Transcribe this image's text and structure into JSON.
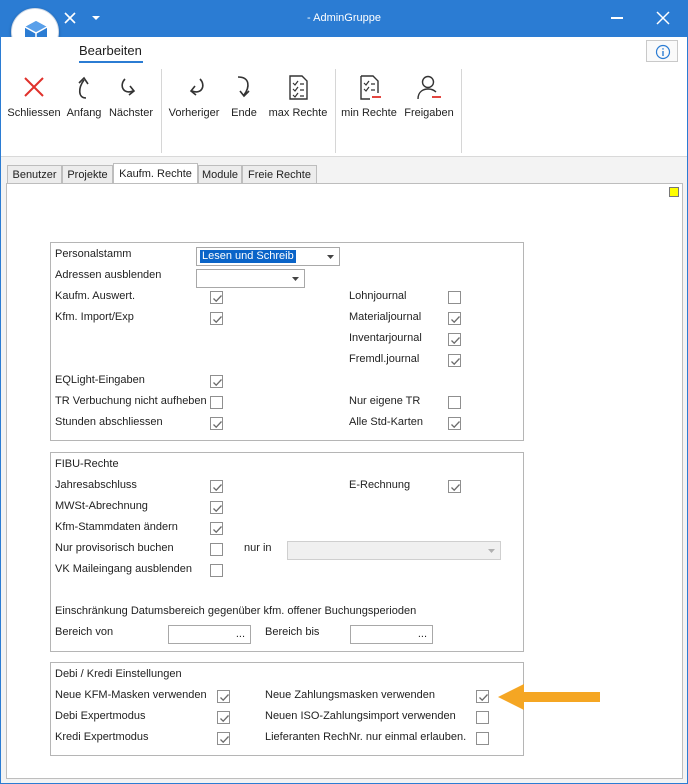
{
  "window": {
    "title": "- AdminGruppe",
    "accent": "#2b7cd3"
  },
  "ribbon": {
    "tab": "Bearbeiten",
    "buttons": [
      {
        "label": "Schliessen",
        "icon": "close-x-icon"
      },
      {
        "label": "Anfang",
        "icon": "arrow-up-curve-icon"
      },
      {
        "label": "Nächster",
        "icon": "redo-icon"
      },
      {
        "label": "Vorheriger",
        "icon": "undo-icon"
      },
      {
        "label": "Ende",
        "icon": "arrow-down-curve-icon"
      },
      {
        "label": "max Rechte",
        "icon": "checklist-icon"
      },
      {
        "label": "min Rechte",
        "icon": "checklist-minus-icon"
      },
      {
        "label": "Freigaben",
        "icon": "user-minus-icon"
      }
    ]
  },
  "tabs": [
    "Benutzer",
    "Projekte",
    "Kaufm. Rechte",
    "Module",
    "Freie Rechte"
  ],
  "active_tab": "Kaufm. Rechte",
  "group1": {
    "personalstamm_label": "Personalstamm",
    "personalstamm_value": "Lesen und Schreib",
    "adressen_label": "Adressen ausblenden",
    "adressen_value": "",
    "left": [
      {
        "label": "Kaufm. Auswert.",
        "checked": true
      },
      {
        "label": "Kfm. Import/Exp",
        "checked": true
      },
      {
        "label": "EQLight-Eingaben",
        "checked": true
      },
      {
        "label": "TR Verbuchung nicht aufheben",
        "checked": false
      },
      {
        "label": "Stunden abschliessen",
        "checked": true
      }
    ],
    "right": [
      {
        "label": "Lohnjournal",
        "checked": false
      },
      {
        "label": "Materialjournal",
        "checked": true
      },
      {
        "label": "Inventarjournal",
        "checked": true
      },
      {
        "label": "Fremdl.journal",
        "checked": true
      },
      {
        "label": "Nur eigene TR",
        "checked": false
      },
      {
        "label": "Alle Std-Karten",
        "checked": true
      }
    ]
  },
  "group2": {
    "title": "FIBU-Rechte",
    "items": [
      {
        "label": "Jahresabschluss",
        "checked": true
      },
      {
        "label": "MWSt-Abrechnung",
        "checked": true
      },
      {
        "label": "Kfm-Stammdaten ändern",
        "checked": true
      },
      {
        "label": "Nur provisorisch buchen",
        "checked": false
      },
      {
        "label": "VK Maileingang ausblenden",
        "checked": false
      }
    ],
    "erechnung": {
      "label": "E-Rechnung",
      "checked": true
    },
    "nur_in_label": "nur in",
    "restriction_label": "Einschränkung Datumsbereich gegenüber kfm. offener Buchungsperioden",
    "bereich_von_label": "Bereich von",
    "bereich_bis_label": "Bereich bis",
    "dots": "..."
  },
  "group3": {
    "title": "Debi / Kredi Einstellungen",
    "left": [
      {
        "label": "Neue KFM-Masken verwenden",
        "checked": true
      },
      {
        "label": "Debi Expertmodus",
        "checked": true
      },
      {
        "label": "Kredi Expertmodus",
        "checked": true
      }
    ],
    "right": [
      {
        "label": "Neue Zahlungsmasken verwenden",
        "checked": true
      },
      {
        "label": "Neuen ISO-Zahlungsimport verwenden",
        "checked": false
      },
      {
        "label": "Lieferanten RechNr. nur einmal erlauben.",
        "checked": false
      }
    ]
  },
  "annotation": {
    "arrow_color": "#f5a623"
  }
}
